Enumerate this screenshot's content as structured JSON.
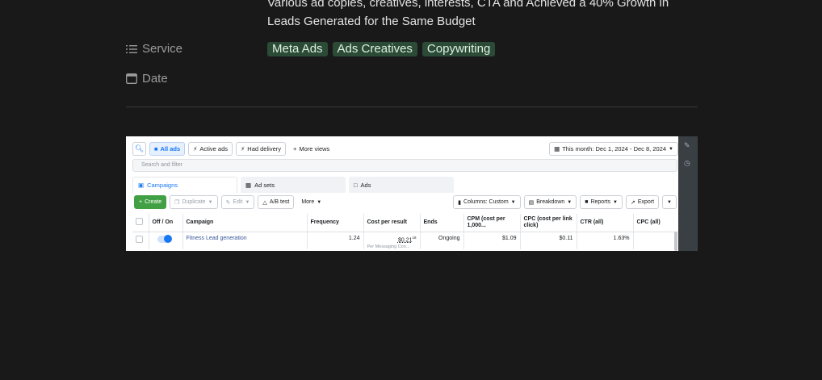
{
  "description_text": "Various ad copies, creatives, interests, CTA and Achieved a 40% Growth in Leads Generated for the Same Budget",
  "properties": {
    "service_label": "Service",
    "service_icon": "list-icon",
    "date_label": "Date",
    "date_icon": "calendar-icon",
    "tags": [
      "Meta Ads",
      "Ads Creatives",
      "Copywriting"
    ],
    "tag_color": "#2b4b36"
  },
  "screenshot": {
    "row1": {
      "all_ads": "All ads",
      "active_ads": "Active ads",
      "had_delivery": "Had delivery",
      "more_views": "More views",
      "date_range": "This month: Dec 1, 2024 - Dec 8, 2024"
    },
    "filter_placeholder": "Search and filter",
    "tabs": [
      "Campaigns",
      "Ad sets",
      "Ads"
    ],
    "toolbar": {
      "create": "Create",
      "duplicate": "Duplicate",
      "edit": "Edit",
      "ab_test": "A/B test",
      "more": "More",
      "columns": "Columns: Custom",
      "breakdown": "Breakdown",
      "reports": "Reports",
      "export": "Export"
    },
    "table": {
      "headers": [
        "Off / On",
        "Campaign",
        "Frequency",
        "Cost per result",
        "Ends",
        "CPM (cost per 1,000...",
        "CPC (cost per link click)",
        "CTR (all)",
        "CPC (all)"
      ],
      "row": {
        "campaign": "Fitness Lead generation",
        "frequency": "1.24",
        "cost_per_result": "$0.21",
        "cost_per_result_sup": "18",
        "cost_per_result_sub": "Per Messaging Con...",
        "ends": "Ongoing",
        "cpm": "$1.09",
        "cpc_link": "$0.11",
        "ctr": "1.63%",
        "cpc_all": ""
      }
    }
  }
}
